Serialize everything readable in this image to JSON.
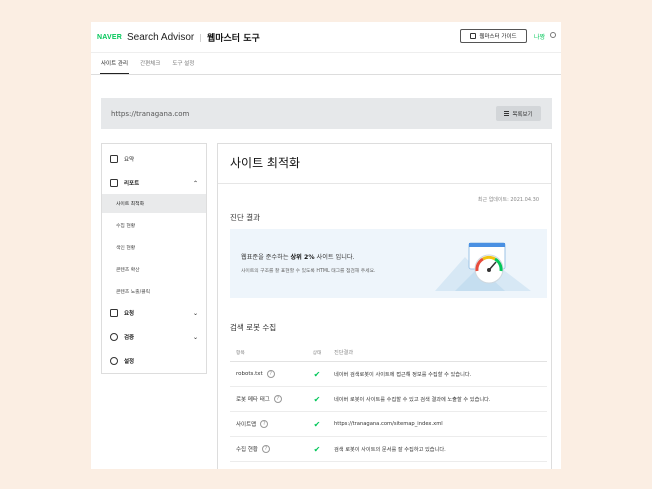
{
  "header": {
    "logo": "NAVER",
    "product": "Search Advisor",
    "tool_title": "웹마스터 도구",
    "guide_label": "웹마스터 가이드",
    "me_label": "나짱"
  },
  "tabs": [
    {
      "label": "사이트 관리",
      "active": true
    },
    {
      "label": "간편체크",
      "active": false
    },
    {
      "label": "도구 설정",
      "active": false
    }
  ],
  "site": {
    "url": "https://tranagana.com",
    "list_button": "목록보기"
  },
  "sidebar": {
    "summary": "요약",
    "report": "리포트",
    "report_children": [
      "사이트 최적화",
      "수집 현황",
      "색인 현황",
      "콘텐츠 확산",
      "콘텐츠 노출/클릭"
    ],
    "request": "요청",
    "verify": "검증",
    "settings": "설정"
  },
  "main": {
    "title": "사이트 최적화",
    "updated": "최근 업데이트: 2021.04.30",
    "diagnosis_title": "진단 결과",
    "result_prefix": "웹표준을 준수하는 ",
    "result_highlight": "상위 2%",
    "result_suffix": " 사이트 입니다.",
    "result_sub": "사이트의 구조를 잘 표현할 수 있도록 HTML 태그를 점검해 주세요.",
    "robot_title": "검색 로봇 수집",
    "table": {
      "headers": [
        "항목",
        "상태",
        "진단결과"
      ],
      "rows": [
        {
          "item": "robots.txt",
          "help": "?",
          "status": "✔",
          "result": "네이버 검색로봇이 사이트에 접근해 정보를 수집할 수 있습니다."
        },
        {
          "item": "로봇 메타 태그",
          "help": "?",
          "status": "✔",
          "result": "네이버 로봇이 사이트를 수집할 수 있고 검색 결과에 노출할 수 있습니다."
        },
        {
          "item": "사이트맵",
          "help": "?",
          "status": "✔",
          "result": "https://tranagana.com/sitemap_index.xml"
        },
        {
          "item": "수집 현황",
          "help": "?",
          "status": "✔",
          "result": "검색 로봇이 사이트의 문서를 잘 수집하고 있습니다."
        }
      ]
    }
  },
  "colors": {
    "brand_green": "#03c75a",
    "background": "#fbeee3",
    "site_bar": "#e6e8ea",
    "result_box": "#eef5fb"
  }
}
